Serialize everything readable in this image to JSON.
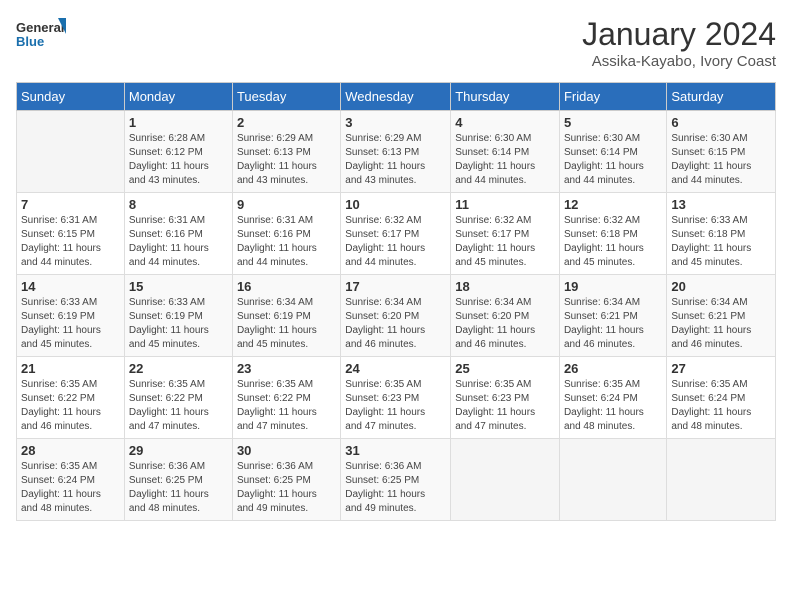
{
  "logo": {
    "line1": "General",
    "line2": "Blue"
  },
  "title": "January 2024",
  "subtitle": "Assika-Kayabo, Ivory Coast",
  "weekdays": [
    "Sunday",
    "Monday",
    "Tuesday",
    "Wednesday",
    "Thursday",
    "Friday",
    "Saturday"
  ],
  "weeks": [
    [
      {
        "day": "",
        "info": ""
      },
      {
        "day": "1",
        "info": "Sunrise: 6:28 AM\nSunset: 6:12 PM\nDaylight: 11 hours\nand 43 minutes."
      },
      {
        "day": "2",
        "info": "Sunrise: 6:29 AM\nSunset: 6:13 PM\nDaylight: 11 hours\nand 43 minutes."
      },
      {
        "day": "3",
        "info": "Sunrise: 6:29 AM\nSunset: 6:13 PM\nDaylight: 11 hours\nand 43 minutes."
      },
      {
        "day": "4",
        "info": "Sunrise: 6:30 AM\nSunset: 6:14 PM\nDaylight: 11 hours\nand 44 minutes."
      },
      {
        "day": "5",
        "info": "Sunrise: 6:30 AM\nSunset: 6:14 PM\nDaylight: 11 hours\nand 44 minutes."
      },
      {
        "day": "6",
        "info": "Sunrise: 6:30 AM\nSunset: 6:15 PM\nDaylight: 11 hours\nand 44 minutes."
      }
    ],
    [
      {
        "day": "7",
        "info": "Sunrise: 6:31 AM\nSunset: 6:15 PM\nDaylight: 11 hours\nand 44 minutes."
      },
      {
        "day": "8",
        "info": "Sunrise: 6:31 AM\nSunset: 6:16 PM\nDaylight: 11 hours\nand 44 minutes."
      },
      {
        "day": "9",
        "info": "Sunrise: 6:31 AM\nSunset: 6:16 PM\nDaylight: 11 hours\nand 44 minutes."
      },
      {
        "day": "10",
        "info": "Sunrise: 6:32 AM\nSunset: 6:17 PM\nDaylight: 11 hours\nand 44 minutes."
      },
      {
        "day": "11",
        "info": "Sunrise: 6:32 AM\nSunset: 6:17 PM\nDaylight: 11 hours\nand 45 minutes."
      },
      {
        "day": "12",
        "info": "Sunrise: 6:32 AM\nSunset: 6:18 PM\nDaylight: 11 hours\nand 45 minutes."
      },
      {
        "day": "13",
        "info": "Sunrise: 6:33 AM\nSunset: 6:18 PM\nDaylight: 11 hours\nand 45 minutes."
      }
    ],
    [
      {
        "day": "14",
        "info": "Sunrise: 6:33 AM\nSunset: 6:19 PM\nDaylight: 11 hours\nand 45 minutes."
      },
      {
        "day": "15",
        "info": "Sunrise: 6:33 AM\nSunset: 6:19 PM\nDaylight: 11 hours\nand 45 minutes."
      },
      {
        "day": "16",
        "info": "Sunrise: 6:34 AM\nSunset: 6:19 PM\nDaylight: 11 hours\nand 45 minutes."
      },
      {
        "day": "17",
        "info": "Sunrise: 6:34 AM\nSunset: 6:20 PM\nDaylight: 11 hours\nand 46 minutes."
      },
      {
        "day": "18",
        "info": "Sunrise: 6:34 AM\nSunset: 6:20 PM\nDaylight: 11 hours\nand 46 minutes."
      },
      {
        "day": "19",
        "info": "Sunrise: 6:34 AM\nSunset: 6:21 PM\nDaylight: 11 hours\nand 46 minutes."
      },
      {
        "day": "20",
        "info": "Sunrise: 6:34 AM\nSunset: 6:21 PM\nDaylight: 11 hours\nand 46 minutes."
      }
    ],
    [
      {
        "day": "21",
        "info": "Sunrise: 6:35 AM\nSunset: 6:22 PM\nDaylight: 11 hours\nand 46 minutes."
      },
      {
        "day": "22",
        "info": "Sunrise: 6:35 AM\nSunset: 6:22 PM\nDaylight: 11 hours\nand 47 minutes."
      },
      {
        "day": "23",
        "info": "Sunrise: 6:35 AM\nSunset: 6:22 PM\nDaylight: 11 hours\nand 47 minutes."
      },
      {
        "day": "24",
        "info": "Sunrise: 6:35 AM\nSunset: 6:23 PM\nDaylight: 11 hours\nand 47 minutes."
      },
      {
        "day": "25",
        "info": "Sunrise: 6:35 AM\nSunset: 6:23 PM\nDaylight: 11 hours\nand 47 minutes."
      },
      {
        "day": "26",
        "info": "Sunrise: 6:35 AM\nSunset: 6:24 PM\nDaylight: 11 hours\nand 48 minutes."
      },
      {
        "day": "27",
        "info": "Sunrise: 6:35 AM\nSunset: 6:24 PM\nDaylight: 11 hours\nand 48 minutes."
      }
    ],
    [
      {
        "day": "28",
        "info": "Sunrise: 6:35 AM\nSunset: 6:24 PM\nDaylight: 11 hours\nand 48 minutes."
      },
      {
        "day": "29",
        "info": "Sunrise: 6:36 AM\nSunset: 6:25 PM\nDaylight: 11 hours\nand 48 minutes."
      },
      {
        "day": "30",
        "info": "Sunrise: 6:36 AM\nSunset: 6:25 PM\nDaylight: 11 hours\nand 49 minutes."
      },
      {
        "day": "31",
        "info": "Sunrise: 6:36 AM\nSunset: 6:25 PM\nDaylight: 11 hours\nand 49 minutes."
      },
      {
        "day": "",
        "info": ""
      },
      {
        "day": "",
        "info": ""
      },
      {
        "day": "",
        "info": ""
      }
    ]
  ]
}
